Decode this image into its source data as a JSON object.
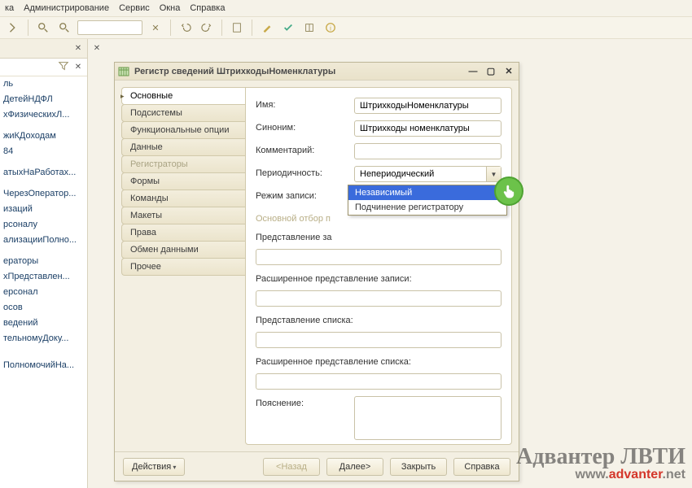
{
  "menu": [
    "ка",
    "Администрирование",
    "Сервис",
    "Окна",
    "Справка"
  ],
  "window": {
    "title": "Регистр сведений ШтрихкодыНоменклатуры"
  },
  "tabs": [
    {
      "label": "Основные",
      "state": "active"
    },
    {
      "label": "Подсистемы",
      "state": ""
    },
    {
      "label": "Функциональные опции",
      "state": ""
    },
    {
      "label": "Данные",
      "state": ""
    },
    {
      "label": "Регистраторы",
      "state": "disabled"
    },
    {
      "label": "Формы",
      "state": ""
    },
    {
      "label": "Команды",
      "state": ""
    },
    {
      "label": "Макеты",
      "state": ""
    },
    {
      "label": "Права",
      "state": ""
    },
    {
      "label": "Обмен данными",
      "state": ""
    },
    {
      "label": "Прочее",
      "state": ""
    }
  ],
  "fields": {
    "name_label": "Имя:",
    "name_value": "ШтрихкодыНоменклатуры",
    "synonym_label": "Синоним:",
    "synonym_value": "Штрихкоды номенклатуры",
    "comment_label": "Комментарий:",
    "comment_value": "",
    "periodicity_label": "Периодичность:",
    "periodicity_value": "Непериодический",
    "record_mode_label": "Режим записи:",
    "record_mode_value": "Независимый",
    "main_filter_label": "Основной отбор п",
    "record_rep_label": "Представление за",
    "record_rep_value": "",
    "ext_record_rep_label": "Расширенное представление записи:",
    "ext_record_rep_value": "",
    "list_rep_label": "Представление списка:",
    "list_rep_value": "",
    "ext_list_rep_label": "Расширенное представление списка:",
    "ext_list_rep_value": "",
    "hint_label": "Пояснение:",
    "hint_value": ""
  },
  "dropdown": {
    "options": [
      "Независимый",
      "Подчинение регистратору"
    ],
    "selected_index": 0
  },
  "buttons": {
    "actions": "Действия",
    "back": "<Назад",
    "next": "Далее>",
    "close": "Закрыть",
    "help": "Справка"
  },
  "tree": {
    "items": [
      "ль",
      "ДетейНДФЛ",
      "хФизическихЛ...",
      "",
      "жиКДоходам",
      "84",
      "",
      "атыхНаРаботах...",
      "",
      "ЧерезОператор...",
      "изаций",
      "рсоналу",
      "ализацииПолно...",
      "",
      "ераторы",
      "хПредставлен...",
      "ерсонал",
      "осов",
      "ведений",
      "тельномуДоку...",
      "",
      "",
      "ПолномочийНа..."
    ]
  },
  "watermark": {
    "big": "Адвантер ЛВТИ",
    "url_a": "www.",
    "url_b": "advanter",
    "url_c": ".net"
  }
}
